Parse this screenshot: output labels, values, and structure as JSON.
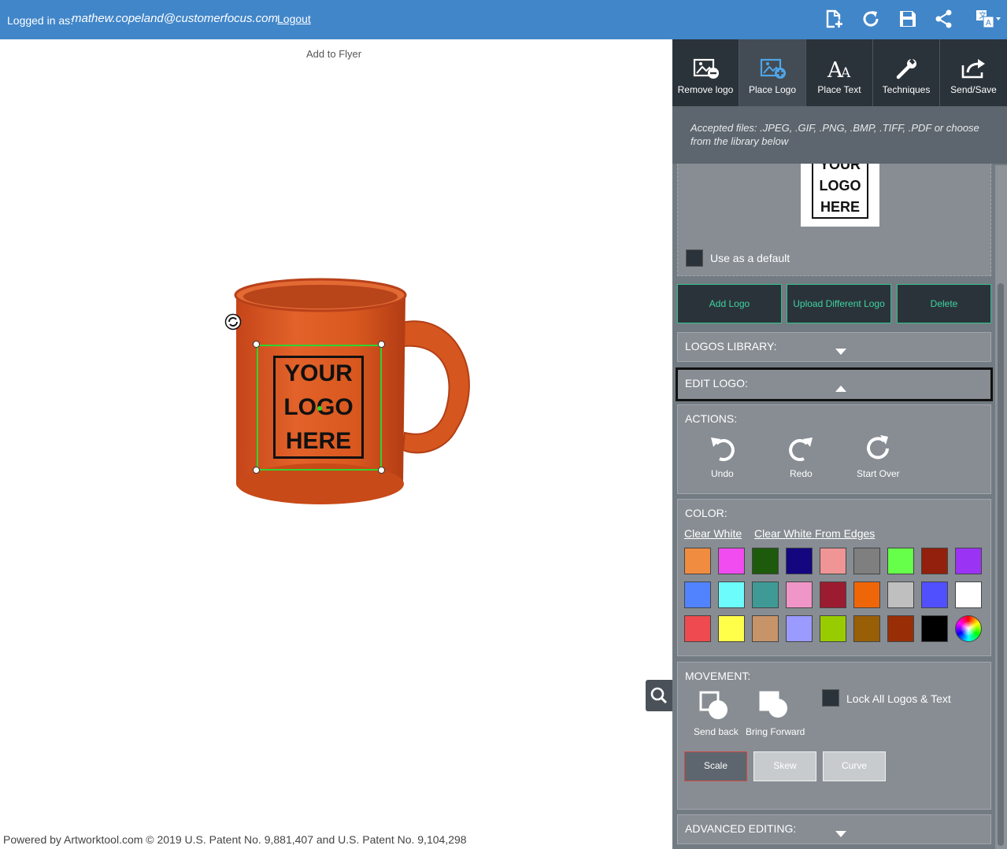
{
  "topbar": {
    "login_label": "Logged in as:",
    "user_email": "mathew.copeland@customerfocus.com",
    "logout_label": "Logout",
    "icons": [
      "add-page-icon",
      "refresh-icon",
      "save-icon",
      "share-icon",
      "translate-icon"
    ],
    "color": "#4186c9"
  },
  "canvas": {
    "add_to_flyer": "Add to Flyer",
    "mug_color": "#d95420",
    "logo_text": [
      "YOUR",
      "LOGO",
      "HERE"
    ],
    "selection_color": "#2fd42f"
  },
  "footer": {
    "text": "Powered by Artworktool.com © 2019 U.S. Patent No. 9,881,407 and U.S. Patent No. 9,104,298"
  },
  "tabs": [
    {
      "label": "Remove logo",
      "icon": "remove-image-icon",
      "active": false
    },
    {
      "label": "Place Logo",
      "icon": "add-image-icon",
      "active": true
    },
    {
      "label": "Place Text",
      "icon": "text-icon",
      "active": false
    },
    {
      "label": "Techniques",
      "icon": "wrench-icon",
      "active": false
    },
    {
      "label": "Send/Save",
      "icon": "share-arrow-icon",
      "active": false
    }
  ],
  "panel": {
    "accepted_files": "Accepted files: .JPEG, .GIF, .PNG, .BMP, .TIFF, .PDF or choose from the library below",
    "preview_text": [
      "YOUR",
      "LOGO",
      "HERE"
    ],
    "use_default_label": "Use as a default",
    "buttons": {
      "add_logo": "Add Logo",
      "upload_different": "Upload Different Logo",
      "delete": "Delete"
    },
    "logos_library_title": "LOGOS LIBRARY:",
    "edit_logo_title": "EDIT LOGO:",
    "actions": {
      "title": "ACTIONS:",
      "undo": "Undo",
      "redo": "Redo",
      "start_over": "Start Over"
    },
    "color": {
      "title": "COLOR:",
      "clear_white": "Clear White",
      "clear_white_edges": "Clear White From Edges",
      "swatches": [
        [
          "#f08c3f",
          "#f04cf0",
          "#1d5a0c",
          "#13067f",
          "#ef9595",
          "#7f7f7f",
          "#66ff4a",
          "#92200c",
          "#9b33f5"
        ],
        [
          "#5283ff",
          "#6dfcfc",
          "#3f9a96",
          "#f095c7",
          "#9b1b30",
          "#ef6608",
          "#bfbfbf",
          "#5050ff",
          "#ffffff"
        ],
        [
          "#ef4a4f",
          "#ffff4a",
          "#c79469",
          "#9a9aff",
          "#99cc00",
          "#995f06",
          "#992e06",
          "#000000",
          "rainbow"
        ]
      ]
    },
    "movement": {
      "title": "MOVEMENT:",
      "send_back": "Send back",
      "bring_forward": "Bring Forward",
      "lock_all": "Lock All Logos & Text",
      "scale": "Scale",
      "skew": "Skew",
      "curve": "Curve",
      "active_mode": "Scale"
    },
    "advanced_title": "ADVANCED EDITING:"
  }
}
